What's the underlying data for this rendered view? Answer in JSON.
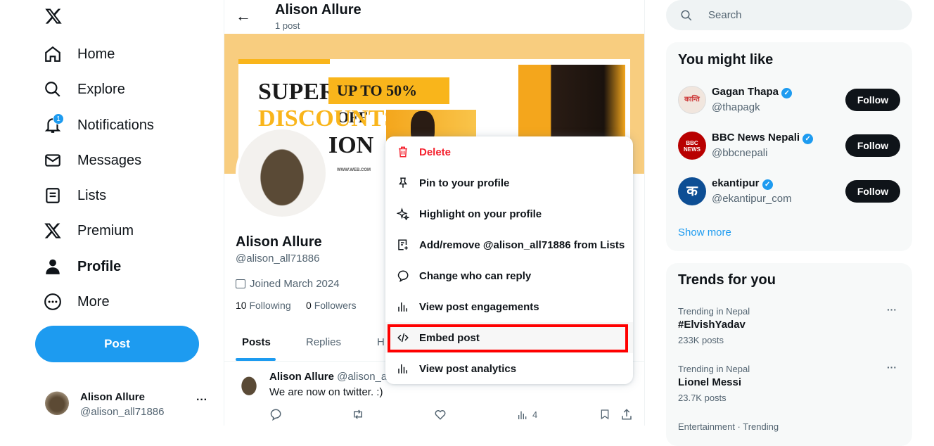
{
  "nav": {
    "items": [
      {
        "label": "Home",
        "icon": "home-icon"
      },
      {
        "label": "Explore",
        "icon": "search-icon"
      },
      {
        "label": "Notifications",
        "icon": "bell-icon",
        "badge": "1"
      },
      {
        "label": "Messages",
        "icon": "mail-icon"
      },
      {
        "label": "Lists",
        "icon": "list-icon"
      },
      {
        "label": "Premium",
        "icon": "x-logo-icon"
      },
      {
        "label": "Profile",
        "icon": "person-icon"
      },
      {
        "label": "More",
        "icon": "more-circle-icon"
      }
    ],
    "post_label": "Post",
    "account": {
      "name": "Alison Allure",
      "handle": "@alison_all71886"
    }
  },
  "header": {
    "title": "Alison Allure",
    "subtitle": "1 post"
  },
  "banner": {
    "line1": "SUPER",
    "offer": "UP TO 50% OFF",
    "line2": "DISCOUNTS",
    "line3": "ION",
    "site": "WWW.WEB.COM",
    "bg_color": "#f8cd7f"
  },
  "profile": {
    "name": "Alison Allure",
    "handle": "@alison_all71886",
    "joined": "Joined March 2024",
    "following_count": "10",
    "following_label": "Following",
    "followers_count": "0",
    "followers_label": "Followers"
  },
  "tabs": [
    "Posts",
    "Replies",
    "H"
  ],
  "post": {
    "name": "Alison Allure",
    "handle": "@alison_a",
    "text": "We are now on twitter. :)",
    "views": "4"
  },
  "menu": {
    "items": [
      {
        "label": "Delete",
        "icon": "trash-icon",
        "color": "#f4212e"
      },
      {
        "label": "Pin to your profile",
        "icon": "pin-icon"
      },
      {
        "label": "Highlight on your profile",
        "icon": "sparkle-icon"
      },
      {
        "label": "Add/remove @alison_all71886 from Lists",
        "icon": "list-add-icon"
      },
      {
        "label": "Change who can reply",
        "icon": "reply-bubble-icon"
      },
      {
        "label": "View post engagements",
        "icon": "bar-chart-icon"
      },
      {
        "label": "Embed post",
        "icon": "code-icon",
        "highlighted": true
      },
      {
        "label": "View post analytics",
        "icon": "bar-chart-icon"
      }
    ]
  },
  "search": {
    "placeholder": "Search"
  },
  "might_like": {
    "title": "You might like",
    "users": [
      {
        "name": "Gagan Thapa",
        "handle": "@thapagk",
        "verified": true,
        "follow": "Follow"
      },
      {
        "name": "BBC News Nepali",
        "handle": "@bbcnepali",
        "verified": true,
        "follow": "Follow",
        "avatar_text": "BBC NEWS"
      },
      {
        "name": "ekantipur",
        "handle": "@ekantipur_com",
        "verified": true,
        "follow": "Follow"
      }
    ],
    "show_more": "Show more"
  },
  "trends": {
    "title": "Trends for you",
    "items": [
      {
        "context": "Trending in Nepal",
        "name": "#ElvishYadav",
        "count": "233K posts"
      },
      {
        "context": "Trending in Nepal",
        "name": "Lionel Messi",
        "count": "23.7K posts"
      },
      {
        "context": "Entertainment · Trending"
      }
    ]
  },
  "colors": {
    "accent": "#1d9bf0",
    "danger": "#f4212e",
    "highlight_box": "#ff0000"
  }
}
